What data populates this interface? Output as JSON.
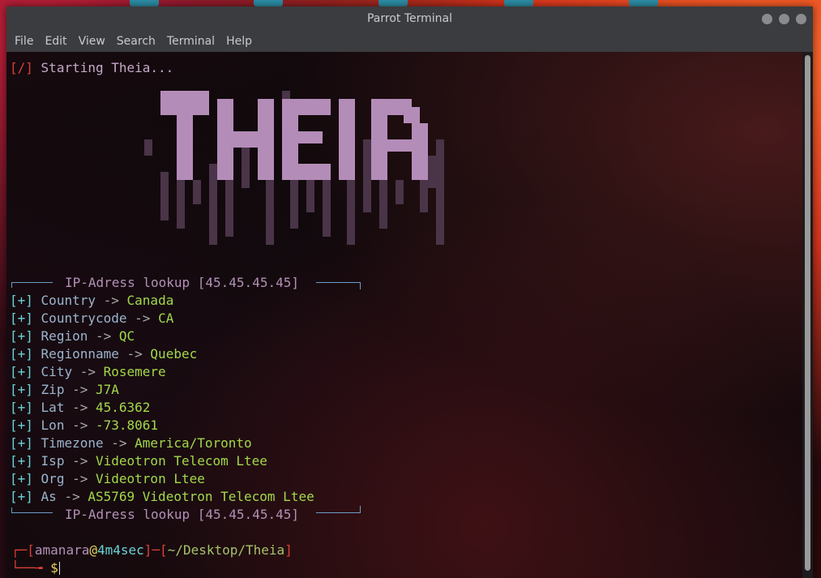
{
  "window": {
    "title": "Parrot Terminal",
    "menu": [
      "File",
      "Edit",
      "View",
      "Search",
      "Terminal",
      "Help"
    ]
  },
  "terminal": {
    "start_marker": "[/]",
    "start_text": "Starting Theia...",
    "logo_text": "THEIA",
    "lookup_header": "IP-Adress lookup [45.45.45.45]",
    "lookup_footer": "IP-Adress lookup [45.45.45.45]",
    "result_marker": "[+]",
    "arrow": "->",
    "results": [
      {
        "key": "Country",
        "value": "Canada"
      },
      {
        "key": "Countrycode",
        "value": "CA"
      },
      {
        "key": "Region",
        "value": "QC"
      },
      {
        "key": "Regionname",
        "value": "Quebec"
      },
      {
        "key": "City",
        "value": "Rosemere"
      },
      {
        "key": "Zip",
        "value": "J7A"
      },
      {
        "key": "Lat",
        "value": "45.6362"
      },
      {
        "key": "Lon",
        "value": "-73.8061"
      },
      {
        "key": "Timezone",
        "value": "America/Toronto"
      },
      {
        "key": "Isp",
        "value": "Videotron Telecom Ltee"
      },
      {
        "key": "Org",
        "value": "Videotron Ltee"
      },
      {
        "key": "As",
        "value": "AS5769 Videotron Telecom Ltee"
      }
    ],
    "prompt": {
      "user": "amanara",
      "at": "@",
      "host": "4m4sec",
      "path": "~/Desktop/Theia",
      "symbol": "$"
    }
  },
  "colors": {
    "accent_red": "#d9413a",
    "bracket_cyan": "#6ad3d7",
    "value_green": "#a3d84a",
    "logo_pink": "#b390b7"
  }
}
